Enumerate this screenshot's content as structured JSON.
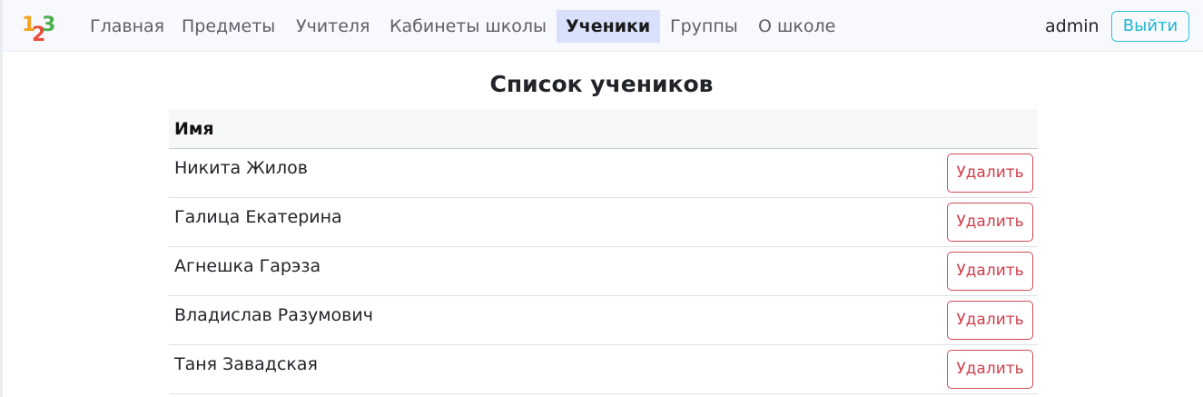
{
  "navbar": {
    "logo_icon": "123-numbers-logo-icon",
    "items": [
      {
        "label": "Главная",
        "active": false
      },
      {
        "label": "Предметы",
        "active": false
      },
      {
        "label": "Учителя",
        "active": false
      },
      {
        "label": "Кабинеты школы",
        "active": false
      },
      {
        "label": "Ученики",
        "active": true
      },
      {
        "label": "Группы",
        "active": false
      },
      {
        "label": "О школе",
        "active": false
      }
    ],
    "user": "admin",
    "logout_label": "Выйти"
  },
  "main": {
    "title": "Список учеников",
    "table": {
      "header": "Имя",
      "delete_label": "Удалить",
      "rows": [
        "Никита Жилов",
        "Галица Екатерина",
        "Агнешка Гарэза",
        "Владислав Разумович",
        "Таня Завадская"
      ]
    }
  },
  "colors": {
    "navbar_bg": "#f8f9fd",
    "active_bg": "#d9e0fb",
    "logout_accent": "#1fb8d4",
    "delete_accent": "#cf3e4b"
  }
}
